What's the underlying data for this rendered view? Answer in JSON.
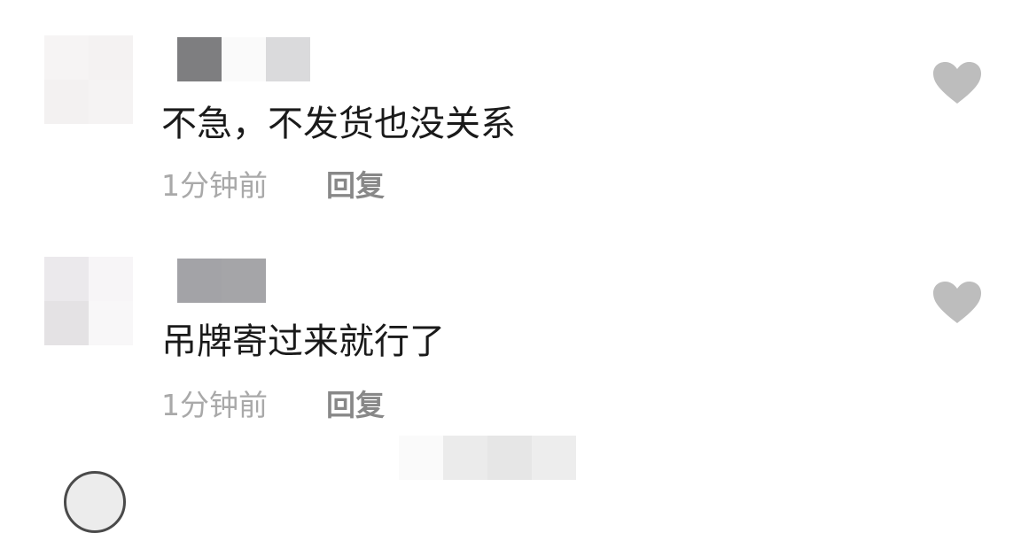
{
  "comments": [
    {
      "text": "不急，不发货也没关系",
      "time": "1分钟前",
      "reply_label": "回复",
      "like_icon": "heart-icon"
    },
    {
      "text": "吊牌寄过来就行了",
      "time": "1分钟前",
      "reply_label": "回复",
      "like_icon": "heart-icon"
    }
  ],
  "colors": {
    "text": "#1a1a1a",
    "meta": "#a9a9a9",
    "reply": "#888888",
    "heart": "#bdbdbd"
  }
}
